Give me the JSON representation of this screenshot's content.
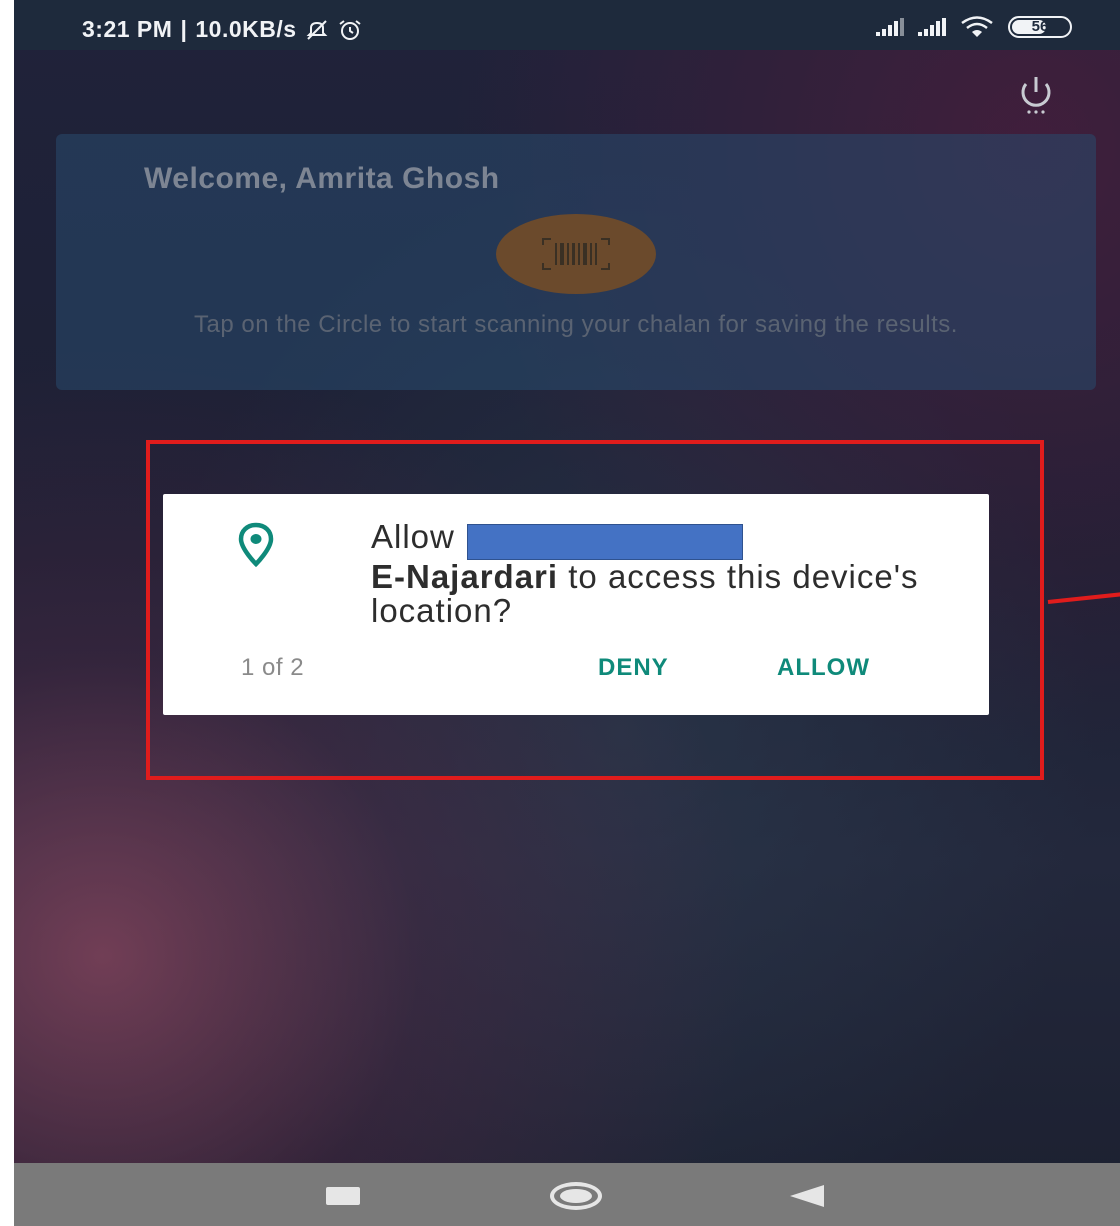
{
  "status_bar": {
    "time": "3:21 PM",
    "separator": "|",
    "network_speed": "10.0KB/s",
    "battery_level": "56",
    "icons": [
      "mute-icon",
      "alarm-icon",
      "signal-icon",
      "signal-icon",
      "wifi-icon",
      "battery-icon"
    ]
  },
  "header": {
    "power_icon": "power-icon"
  },
  "welcome": {
    "title": "Welcome, Amrita Ghosh",
    "scan_icon": "barcode-icon",
    "hint": "Tap on the Circle to start scanning your chalan for saving the results."
  },
  "dialog": {
    "icon": "location-pin-icon",
    "prefix": "Allow",
    "app_name": "E-Najardari",
    "suffix": "to access this device's location?",
    "counter": "1 of 2",
    "deny_label": "DENY",
    "allow_label": "ALLOW"
  },
  "nav": {
    "icons": [
      "recents-icon",
      "home-icon",
      "back-icon"
    ]
  },
  "colors": {
    "accent": "#0f8a7a",
    "highlight": "#e01c1c",
    "redaction": "#4472c4",
    "scan_circle": "#6b4a2c"
  }
}
